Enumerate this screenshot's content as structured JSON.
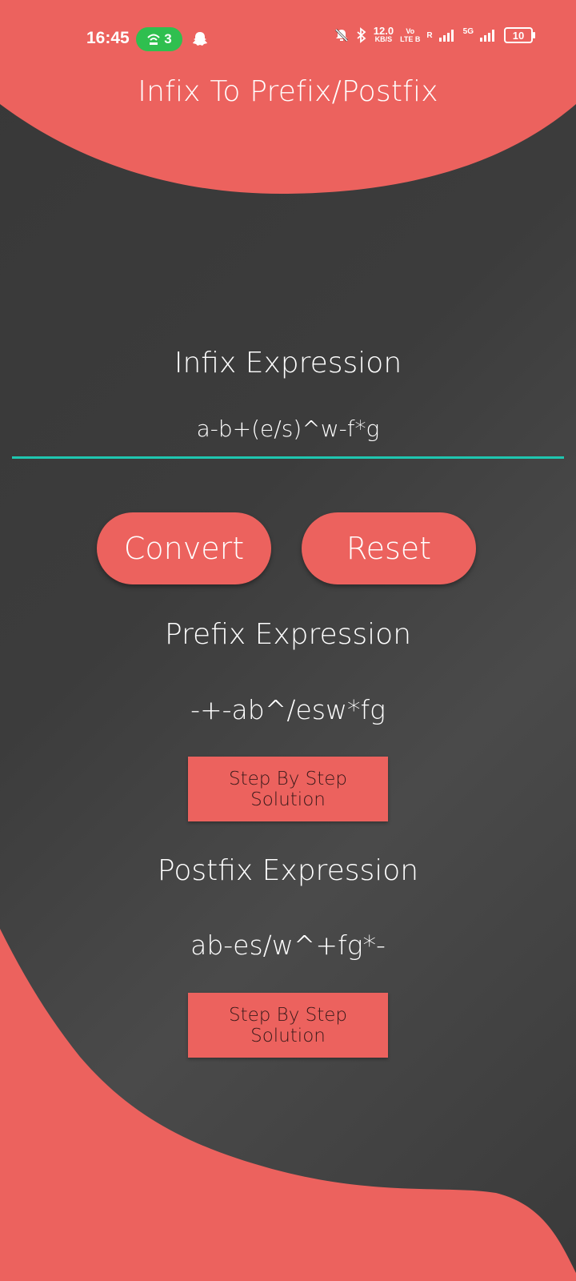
{
  "status_bar": {
    "time": "16:45",
    "hotspot_count": "3",
    "network_speed_value": "12.0",
    "network_speed_unit": "KB/S",
    "volte_top": "Vo",
    "volte_bottom": "LTE B",
    "roaming": "R",
    "network_type": "5G",
    "battery": "10"
  },
  "app": {
    "title": "Infix To Prefix/Postfix"
  },
  "infix": {
    "label": "Infix Expression",
    "value": "a-b+(e/s)^w-f*g"
  },
  "buttons": {
    "convert": "Convert",
    "reset": "Reset"
  },
  "prefix": {
    "label": "Prefix Expression",
    "result": "-+-ab^/esw*fg",
    "step_button": "Step By Step Solution"
  },
  "postfix": {
    "label": "Postfix Expression",
    "result": "ab-es/w^+fg*-",
    "step_button": "Step By Step Solution"
  },
  "colors": {
    "accent": "#ec625e",
    "background": "#3c3c3c",
    "input_underline": "#1fc6b0",
    "hotspot_pill": "#2fbf4f"
  }
}
